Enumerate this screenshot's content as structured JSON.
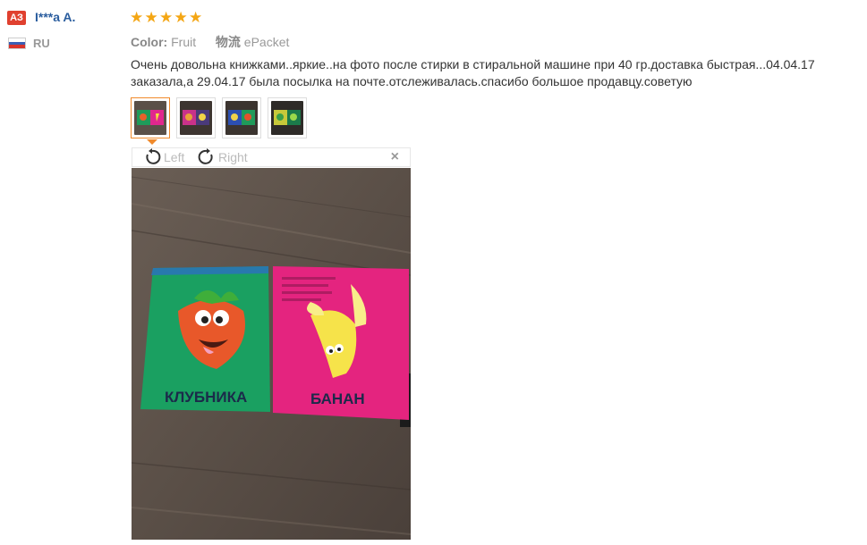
{
  "reviewer": {
    "avatar_initials": "АЗ",
    "name": "I***a A.",
    "country": "RU",
    "rating": 5
  },
  "product": {
    "color_label": "Color:",
    "color_value": "Fruit",
    "shipping_label": "物流",
    "shipping_value": "ePacket"
  },
  "review": {
    "text": "Очень довольна книжками..яркие..на фото после стирки в стиральной машине при 40 гр.доставка быстрая...04.04.17 заказала,а 29.04.17 была посылка на почте.отслеживалась.спасибо большое продавцу.советую"
  },
  "gallery": {
    "thumb_count": 4,
    "active_index": 0,
    "rotate_left_label": "Left",
    "rotate_right_label": "Right",
    "close_symbol": "×"
  },
  "photo": {
    "left_page_caption": "КЛУБНИКА",
    "right_page_caption": "БАНАН"
  },
  "colors": {
    "accent_orange": "#f08a2b",
    "star": "#f4a614",
    "link_blue": "#2a5d9e",
    "badge_red": "#e0402f"
  }
}
